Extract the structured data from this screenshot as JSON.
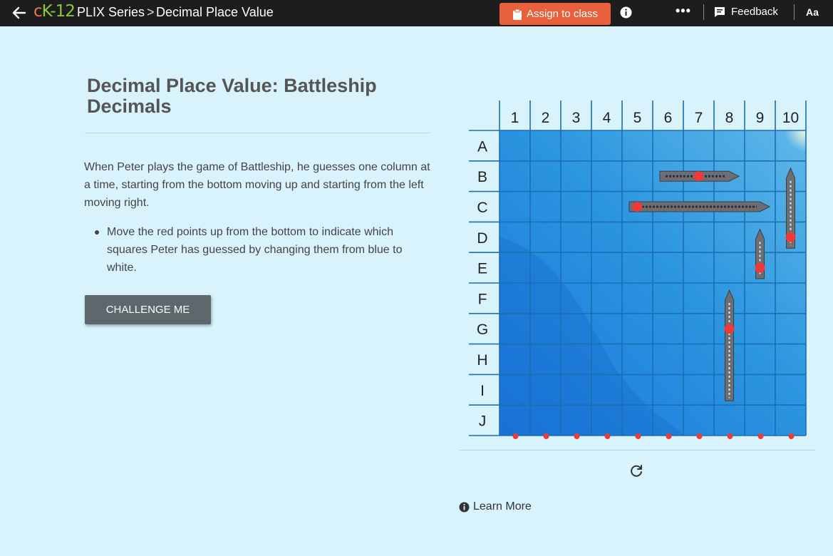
{
  "header": {
    "logo": {
      "c": "c",
      "k": "K-12"
    },
    "series": "PLIX Series",
    "separator": ">",
    "title": "Decimal Place Value",
    "assign_label": "Assign to class",
    "more_label": "•••",
    "feedback_label": "Feedback",
    "font_size_label": "Aa"
  },
  "content": {
    "title": "Decimal Place Value: Battleship Decimals",
    "intro": "When Peter plays the game of Battleship, he guesses one column at a time, starting from the bottom moving up and starting from the left moving right.",
    "bullet": "Move the red points up from the bottom to indicate which squares Peter has guessed by changing them from blue to white.",
    "challenge_label": "CHALLENGE ME"
  },
  "game": {
    "columns": [
      "1",
      "2",
      "3",
      "4",
      "5",
      "6",
      "7",
      "8",
      "9",
      "10"
    ],
    "rows": [
      "A",
      "B",
      "C",
      "D",
      "E",
      "F",
      "G",
      "H",
      "I",
      "J"
    ],
    "guess_points_at_bottom": 10,
    "ships": [
      {
        "name": "ship-b",
        "orientation": "horizontal",
        "row": "B",
        "cols": [
          6,
          7,
          8
        ]
      },
      {
        "name": "ship-c",
        "orientation": "horizontal",
        "row": "C",
        "cols": [
          5,
          6,
          7,
          8,
          9
        ]
      },
      {
        "name": "ship-col10",
        "orientation": "vertical",
        "col": 10,
        "rows": [
          "B",
          "C",
          "D"
        ]
      },
      {
        "name": "ship-col9",
        "orientation": "vertical",
        "col": 9,
        "rows": [
          "D",
          "E"
        ]
      },
      {
        "name": "ship-col8",
        "orientation": "vertical",
        "col": 8,
        "rows": [
          "F",
          "G",
          "H",
          "I"
        ]
      }
    ],
    "red_markers": [
      {
        "row": "B",
        "col": 7
      },
      {
        "row": "C",
        "col": 5
      },
      {
        "row": "D",
        "col": 10
      },
      {
        "row": "E",
        "col": 9
      },
      {
        "row": "G",
        "col": 8
      }
    ],
    "colors": {
      "water": "#2a92dd",
      "grid_line": "#1a6fb5",
      "marker": "#f03a3a",
      "ship": "#6b6e72"
    }
  },
  "footer": {
    "reset_icon": "refresh-icon",
    "learn_more": "Learn More"
  }
}
